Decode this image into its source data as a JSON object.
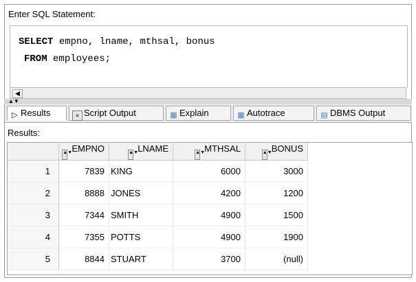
{
  "editor": {
    "label": "Enter SQL Statement:",
    "line1_keyword": "SELECT",
    "line1_rest": " empno, lname, mthsal, bonus",
    "line2_keyword": "FROM",
    "line2_rest": " employees;"
  },
  "tabs": [
    {
      "label": "Results",
      "icon": "play-icon"
    },
    {
      "label": "Script Output",
      "icon": "script-icon"
    },
    {
      "label": "Explain",
      "icon": "explain-icon"
    },
    {
      "label": "Autotrace",
      "icon": "autotrace-icon"
    },
    {
      "label": "DBMS Output",
      "icon": "dbms-icon"
    }
  ],
  "results": {
    "label": "Results:",
    "columns": [
      "EMPNO",
      "LNAME",
      "MTHSAL",
      "BONUS"
    ],
    "rows": [
      {
        "num": "1",
        "empno": "7839",
        "lname": "KING",
        "mthsal": "6000",
        "bonus": "3000"
      },
      {
        "num": "2",
        "empno": "8888",
        "lname": "JONES",
        "mthsal": "4200",
        "bonus": "1200"
      },
      {
        "num": "3",
        "empno": "7344",
        "lname": "SMITH",
        "mthsal": "4900",
        "bonus": "1500"
      },
      {
        "num": "4",
        "empno": "7355",
        "lname": "POTTS",
        "mthsal": "4900",
        "bonus": "1900"
      },
      {
        "num": "5",
        "empno": "8844",
        "lname": "STUART",
        "mthsal": "3700",
        "bonus": "(null)"
      }
    ]
  }
}
